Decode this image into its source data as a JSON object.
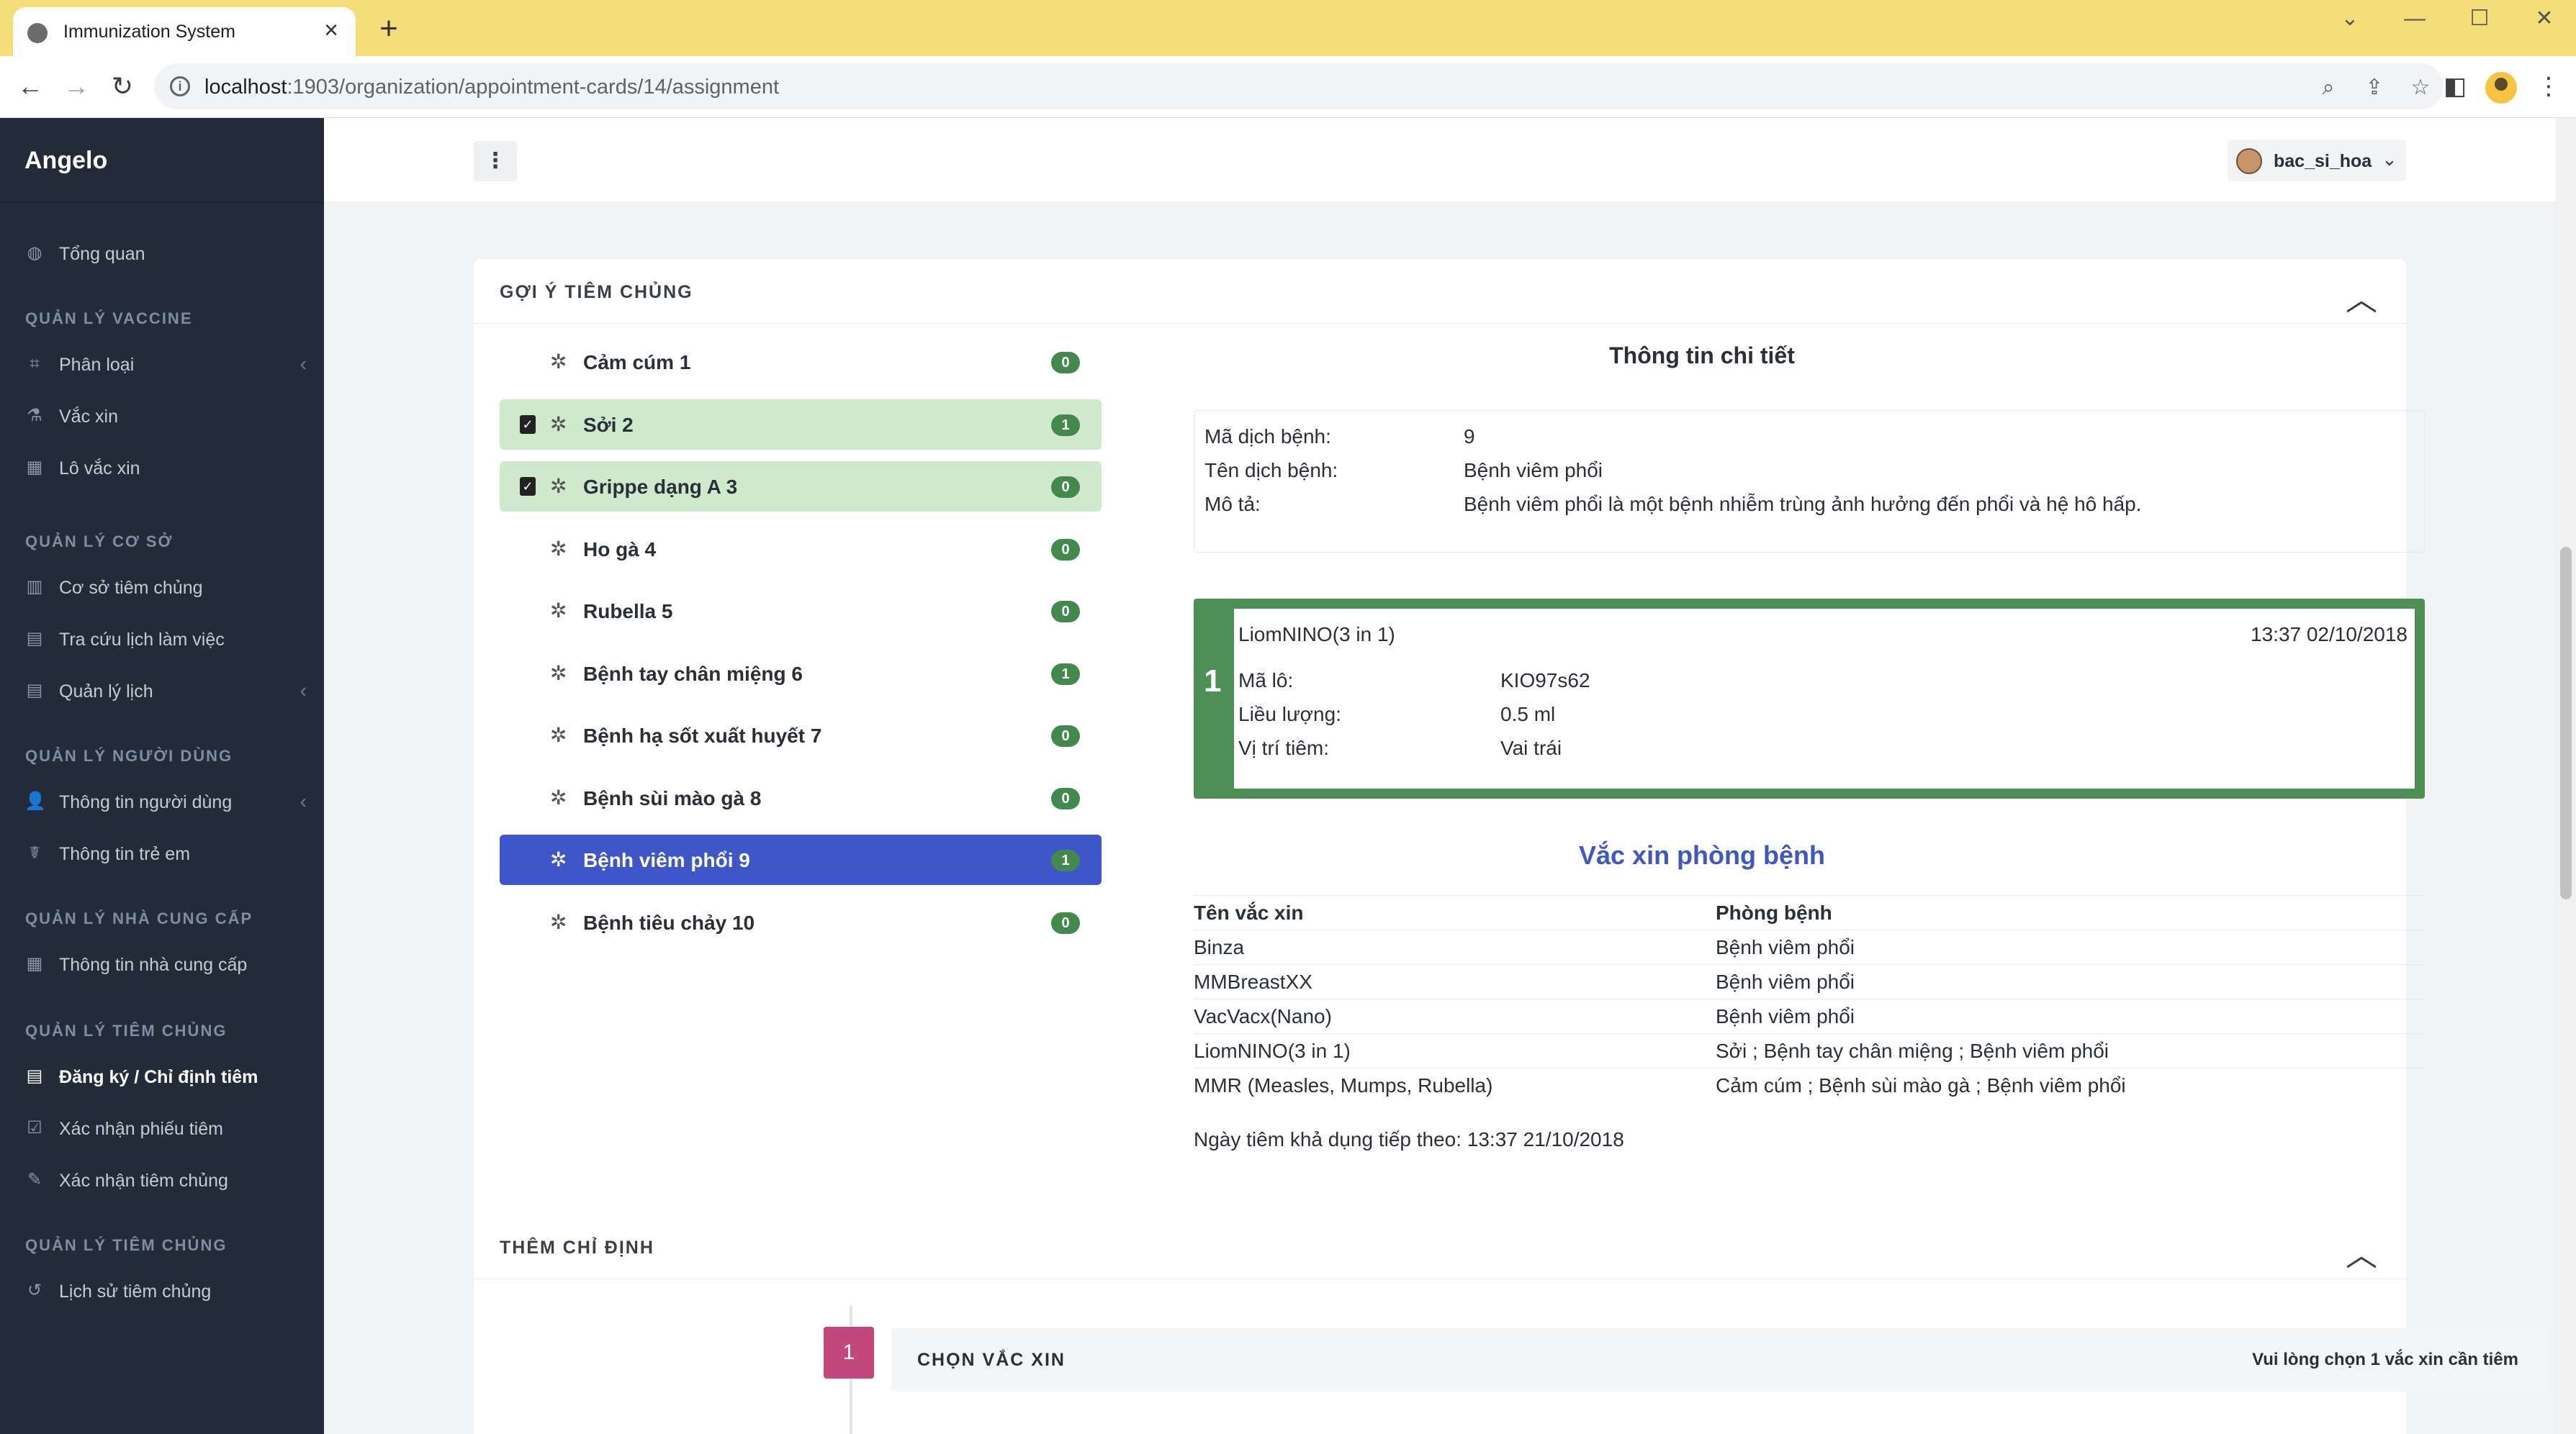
{
  "browser": {
    "tab_title": "Immunization System",
    "url_host": "localhost",
    "url_rest": ":1903/organization/appointment-cards/14/assignment"
  },
  "sidebar": {
    "brand": "Angelo",
    "overview": "Tổng quan",
    "sections": {
      "vaccine": "QUẢN LÝ VACCINE",
      "facility": "QUẢN LÝ CƠ SỞ",
      "users": "QUẢN LÝ NGƯỜI DÙNG",
      "suppliers": "QUẢN LÝ NHÀ CUNG CẤP",
      "immunization": "QUẢN LÝ TIÊM CHỦNG",
      "immunization2": "QUẢN LÝ TIÊM CHỦNG"
    },
    "items": {
      "classify": "Phân loại",
      "vaccine": "Vắc xin",
      "batch": "Lô vắc xin",
      "facility": "Cơ sở tiêm chủng",
      "schedule_lookup": "Tra cứu lịch làm việc",
      "schedule_manage": "Quản lý lịch",
      "user_info": "Thông tin người dùng",
      "child_info": "Thông tin trẻ em",
      "supplier_info": "Thông tin nhà cung cấp",
      "register": "Đăng ký / Chỉ định tiêm",
      "confirm_card": "Xác nhận phiếu tiêm",
      "confirm_vacc": "Xác nhận tiêm chủng",
      "history": "Lịch sử tiêm chủng"
    }
  },
  "header": {
    "username": "bac_si_hoa"
  },
  "suggest": {
    "title": "GỢI Ý TIÊM CHỦNG",
    "diseases": [
      {
        "name": "Cảm cúm 1",
        "count": "0",
        "state": "normal"
      },
      {
        "name": "Sởi 2",
        "count": "1",
        "state": "done"
      },
      {
        "name": "Grippe dạng A 3",
        "count": "0",
        "state": "done"
      },
      {
        "name": "Ho gà 4",
        "count": "0",
        "state": "normal"
      },
      {
        "name": "Rubella 5",
        "count": "0",
        "state": "normal"
      },
      {
        "name": "Bệnh tay chân miệng 6",
        "count": "1",
        "state": "normal"
      },
      {
        "name": "Bệnh hạ sốt xuất huyết 7",
        "count": "0",
        "state": "normal"
      },
      {
        "name": "Bệnh sùi mào gà 8",
        "count": "0",
        "state": "normal"
      },
      {
        "name": "Bệnh viêm phổi 9",
        "count": "1",
        "state": "selected"
      },
      {
        "name": "Bệnh tiêu chảy 10",
        "count": "0",
        "state": "normal"
      }
    ],
    "detail": {
      "title": "Thông tin chi tiết",
      "code_label": "Mã dịch bệnh:",
      "code_value": "9",
      "name_label": "Tên dịch bệnh:",
      "name_value": "Bệnh viêm phổi",
      "desc_label": "Mô tả:",
      "desc_value": "Bệnh viêm phổi là một bệnh nhiễm trùng ảnh hưởng đến phổi và hệ hô hấp."
    },
    "injection": {
      "number": "1",
      "vaccine": "LiomNINO(3 in 1)",
      "datetime": "13:37 02/10/2018",
      "batch_label": "Mã lô:",
      "batch_value": "KIO97s62",
      "dose_label": "Liều lượng:",
      "dose_value": "0.5 ml",
      "site_label": "Vị trí tiêm:",
      "site_value": "Vai trái"
    },
    "vaccines": {
      "title": "Vắc xin phòng bệnh",
      "col_name": "Tên vắc xin",
      "col_disease": "Phòng bệnh",
      "rows": [
        {
          "name": "Binza",
          "disease": "Bệnh viêm phổi"
        },
        {
          "name": "MMBreastXX",
          "disease": "Bệnh viêm phổi"
        },
        {
          "name": "VacVacx(Nano)",
          "disease": "Bệnh viêm phổi"
        },
        {
          "name": "LiomNINO(3 in 1)",
          "disease": "Sởi ; Bệnh tay chân miệng ; Bệnh viêm phổi"
        },
        {
          "name": "MMR (Measles, Mumps, Rubella)",
          "disease": "Cảm cúm ; Bệnh sùi mào gà ; Bệnh viêm phổi"
        }
      ]
    },
    "next_date": "Ngày tiêm khả dụng tiếp theo: 13:37 21/10/2018"
  },
  "assign": {
    "title": "THÊM CHỈ ĐỊNH",
    "step_number": "1",
    "step_label": "CHỌN VẮC XIN",
    "step_hint": "Vui lòng chọn 1 vắc xin cần tiêm"
  },
  "colors": {
    "sidebar": "#232b38",
    "selected": "#3f56c8",
    "done": "#cfe9cc",
    "badge": "#43884d",
    "injection": "#4e8f55",
    "step": "#c2477c"
  }
}
